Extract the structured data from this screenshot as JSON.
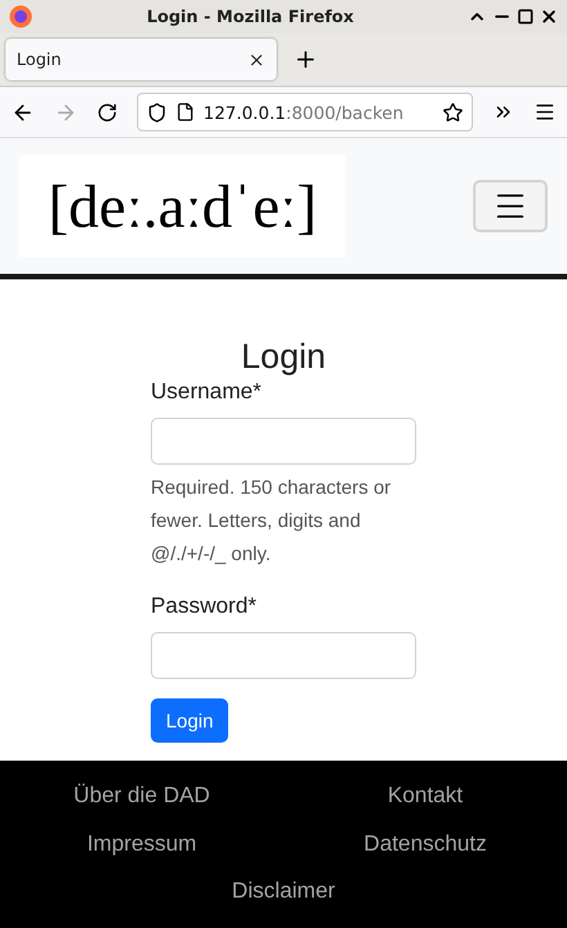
{
  "window": {
    "title": "Login - Mozilla Firefox"
  },
  "tabs": [
    {
      "label": "Login",
      "selected": true
    }
  ],
  "address": {
    "host": "127.0.0.1",
    "rest": ":8000/backen"
  },
  "logo": "[deː.aːdˈeː]",
  "form": {
    "heading": "Login",
    "fields": [
      {
        "label": "Username*",
        "help": "Required. 150 characters or fewer. Letters, digits and @/./+/-/_ only."
      },
      {
        "label": "Password*"
      }
    ],
    "submit": "Login"
  },
  "footer": [
    "Über die DAD",
    "Kontakt",
    "Impressum",
    "Datenschutz",
    "Disclaimer"
  ]
}
